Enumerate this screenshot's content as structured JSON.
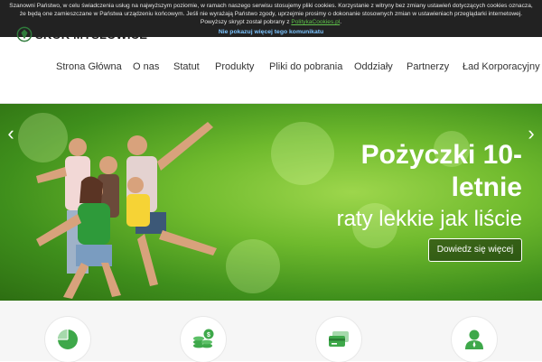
{
  "cookie": {
    "message": "Szanowni Państwo, w celu świadczenia usług na najwyższym poziomie, w ramach naszego serwisu stosujemy pliki cookies. Korzystanie z witryny bez zmiany ustawień dotyczących cookies oznacza, że będą one zamieszczane w Państwa urządzeniu końcowym. Jeśli nie wyrażają Państwo zgody, uprzejmie prosimy o dokonanie stosownych zmian w ustawieniach przeglądarki internetowej. Powyższy skrypt został pobrany z",
    "link_label": "PolitykaCookies.pl",
    "dismiss_label": "Nie pokazuj więcej tego komunikatu"
  },
  "header": {
    "logo_text": "SKOK MYSŁOWICE",
    "nav": [
      {
        "label": "Strona Główna"
      },
      {
        "label": "O nas"
      },
      {
        "label": "Statut"
      },
      {
        "label": "Produkty"
      },
      {
        "label": "Pliki do pobrania"
      },
      {
        "label": "Oddziały"
      },
      {
        "label": "Partnerzy"
      },
      {
        "label": "Ład Korporacyjny"
      }
    ]
  },
  "hero": {
    "title_line1": "Pożyczki 10-",
    "title_line2": "letnie",
    "subtitle": "raty lekkie jak liście",
    "button_label": "Dowiedz się więcej",
    "prev_arrow": "‹",
    "next_arrow": "›",
    "accent_color": "#5aa82b"
  },
  "features": [
    {
      "icon": "pie-chart-icon"
    },
    {
      "icon": "coins-icon"
    },
    {
      "icon": "credit-card-icon"
    },
    {
      "icon": "user-icon"
    }
  ],
  "colors": {
    "brand_green": "#3ea84a",
    "cookie_bg": "#222222",
    "link_blue": "#7cc4ff"
  }
}
